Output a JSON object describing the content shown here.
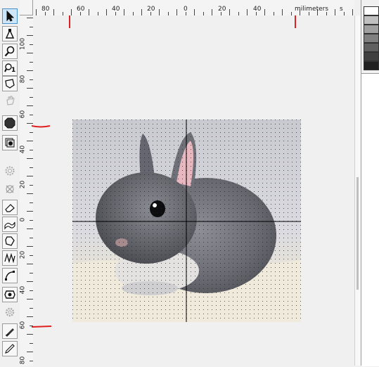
{
  "toolbox": {
    "tools": [
      {
        "name": "pointer-tool",
        "icon": "arrow-pointer-icon",
        "selected": true,
        "enabled": true
      },
      {
        "name": "node-edit-tool",
        "icon": "node-edit-icon",
        "selected": false,
        "enabled": true
      },
      {
        "name": "zoom-tool",
        "icon": "magnifier-icon",
        "selected": false,
        "enabled": true
      },
      {
        "name": "zoom-actual-tool",
        "icon": "magnifier-one-icon",
        "selected": false,
        "enabled": true
      },
      {
        "name": "polygon-select-tool",
        "icon": "polygon-select-icon",
        "selected": false,
        "enabled": true
      },
      {
        "name": "pan-tool",
        "icon": "hand-icon",
        "selected": false,
        "enabled": false
      },
      {
        "name": "shape-tool",
        "icon": "octagon-icon",
        "selected": false,
        "enabled": true
      },
      {
        "name": "layers-tool",
        "icon": "stacked-layers-icon",
        "selected": false,
        "enabled": true
      },
      {
        "name": "gear-tool",
        "icon": "gear-outline-icon",
        "selected": false,
        "enabled": false
      },
      {
        "name": "transform-tool",
        "icon": "transform-icon",
        "selected": false,
        "enabled": false
      },
      {
        "name": "eraser-tool",
        "icon": "eraser-icon",
        "selected": false,
        "enabled": true
      },
      {
        "name": "ribbon-tool",
        "icon": "ribbon-icon",
        "selected": false,
        "enabled": true
      },
      {
        "name": "lasso-tool",
        "icon": "lasso-icon",
        "selected": false,
        "enabled": true
      },
      {
        "name": "zigzag-tool",
        "icon": "zigzag-icon",
        "selected": false,
        "enabled": true
      },
      {
        "name": "curve-tool",
        "icon": "curve-icon",
        "selected": false,
        "enabled": true
      },
      {
        "name": "stamp-tool",
        "icon": "stamp-icon",
        "selected": false,
        "enabled": true
      },
      {
        "name": "settings-tool",
        "icon": "gear-icon",
        "selected": false,
        "enabled": false
      },
      {
        "name": "pen-tool",
        "icon": "pen-icon",
        "selected": false,
        "enabled": true
      },
      {
        "name": "pencil-tool",
        "icon": "pencil-icon",
        "selected": false,
        "enabled": true
      }
    ]
  },
  "rulers": {
    "unit_label": "milimeters",
    "unit_suffix": "s",
    "top_labels": [
      "80",
      "60",
      "40",
      "20",
      "0",
      "20",
      "40"
    ],
    "left_labels": [
      "100",
      "80",
      "60",
      "40",
      "20",
      "0",
      "20",
      "40",
      "60",
      "80"
    ]
  },
  "colors": {
    "guide_mark": "#e02020",
    "selection_blue": "#cfe6f8",
    "palette": [
      "#ffffff",
      "#c0c0c0",
      "#a0a0a0",
      "#808080",
      "#606060",
      "#404040",
      "#202020"
    ]
  },
  "canvas": {
    "photo_subject": "gray baby bunny on white fur with dotted grid overlay"
  }
}
